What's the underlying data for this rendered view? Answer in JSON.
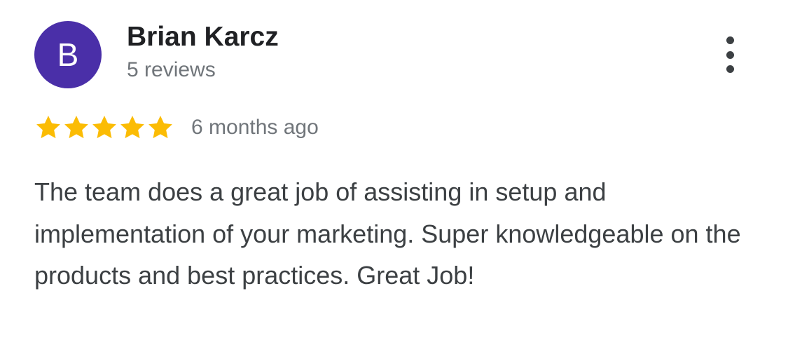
{
  "reviewer": {
    "initial": "B",
    "name": "Brian Karcz",
    "review_count": "5 reviews",
    "avatar_color": "#4a2fa8"
  },
  "menu": {
    "icon": "more-vertical-icon"
  },
  "rating": {
    "stars": 5,
    "max_stars": 5,
    "star_color": "#fbbc04",
    "date": "6 months ago"
  },
  "review": {
    "text": "The team does a great job of assisting in setup and implementation of your marketing. Super knowledgeable on the products and best practices. Great Job!"
  }
}
